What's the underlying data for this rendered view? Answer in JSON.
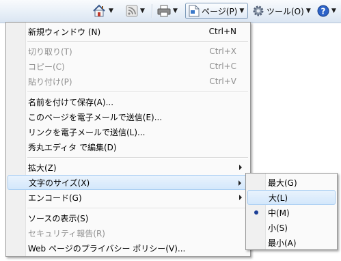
{
  "toolbar": {
    "home_icon": "home-icon",
    "feeds_icon": "feeds-icon",
    "print_icon": "printer-icon",
    "page_label": "ページ(P)",
    "tools_label": "ツール(O)",
    "help_icon": "help-icon"
  },
  "page_menu": {
    "items": [
      {
        "label": "新規ウィンドウ (N)",
        "shortcut": "Ctrl+N",
        "enabled": true
      },
      {
        "label": "切り取り(T)",
        "shortcut": "Ctrl+X",
        "enabled": false
      },
      {
        "label": "コピー(C)",
        "shortcut": "Ctrl+C",
        "enabled": false
      },
      {
        "label": "貼り付け(P)",
        "shortcut": "Ctrl+V",
        "enabled": false
      },
      {
        "label": "名前を付けて保存(A)...",
        "enabled": true
      },
      {
        "label": "このページを電子メールで送信(E)...",
        "enabled": true
      },
      {
        "label": "リンクを電子メールで送信(L)...",
        "enabled": true
      },
      {
        "label": "秀丸エディタ で編集(D)",
        "enabled": true
      },
      {
        "label": "拡大(Z)",
        "enabled": true,
        "submenu": true
      },
      {
        "label": "文字のサイズ(X)",
        "enabled": true,
        "submenu": true,
        "highlighted": true
      },
      {
        "label": "エンコード(G)",
        "enabled": true,
        "submenu": true
      },
      {
        "label": "ソースの表示(S)",
        "enabled": true
      },
      {
        "label": "セキュリティ報告(R)",
        "enabled": false
      },
      {
        "label": "Web ページのプライバシー ポリシー(V)...",
        "enabled": true
      }
    ]
  },
  "text_size_menu": {
    "items": [
      {
        "label": "最大(G)"
      },
      {
        "label": "大(L)",
        "highlighted": true
      },
      {
        "label": "中(M)",
        "selected": true
      },
      {
        "label": "小(S)"
      },
      {
        "label": "最小(A)"
      }
    ]
  }
}
